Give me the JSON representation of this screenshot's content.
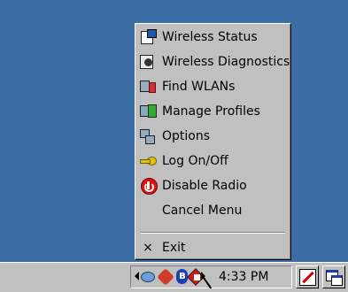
{
  "menu": {
    "items": [
      {
        "label": "Wireless Status",
        "icon": "wireless-status-icon"
      },
      {
        "label": "Wireless Diagnostics",
        "icon": "wireless-diagnostics-icon"
      },
      {
        "label": "Find WLANs",
        "icon": "find-wlans-icon"
      },
      {
        "label": "Manage Profiles",
        "icon": "manage-profiles-icon"
      },
      {
        "label": "Options",
        "icon": "options-icon"
      },
      {
        "label": "Log On/Off",
        "icon": "key-icon"
      },
      {
        "label": "Disable Radio",
        "icon": "power-icon"
      },
      {
        "label": "Cancel Menu",
        "icon": ""
      }
    ],
    "exit_label": "Exit",
    "exit_glyph": "×"
  },
  "taskbar": {
    "clock": "4:33 PM"
  },
  "colors": {
    "desktop": "#3a6ea5",
    "menu_bg": "#c0c0c0",
    "disable_radio_red": "#e01010"
  }
}
